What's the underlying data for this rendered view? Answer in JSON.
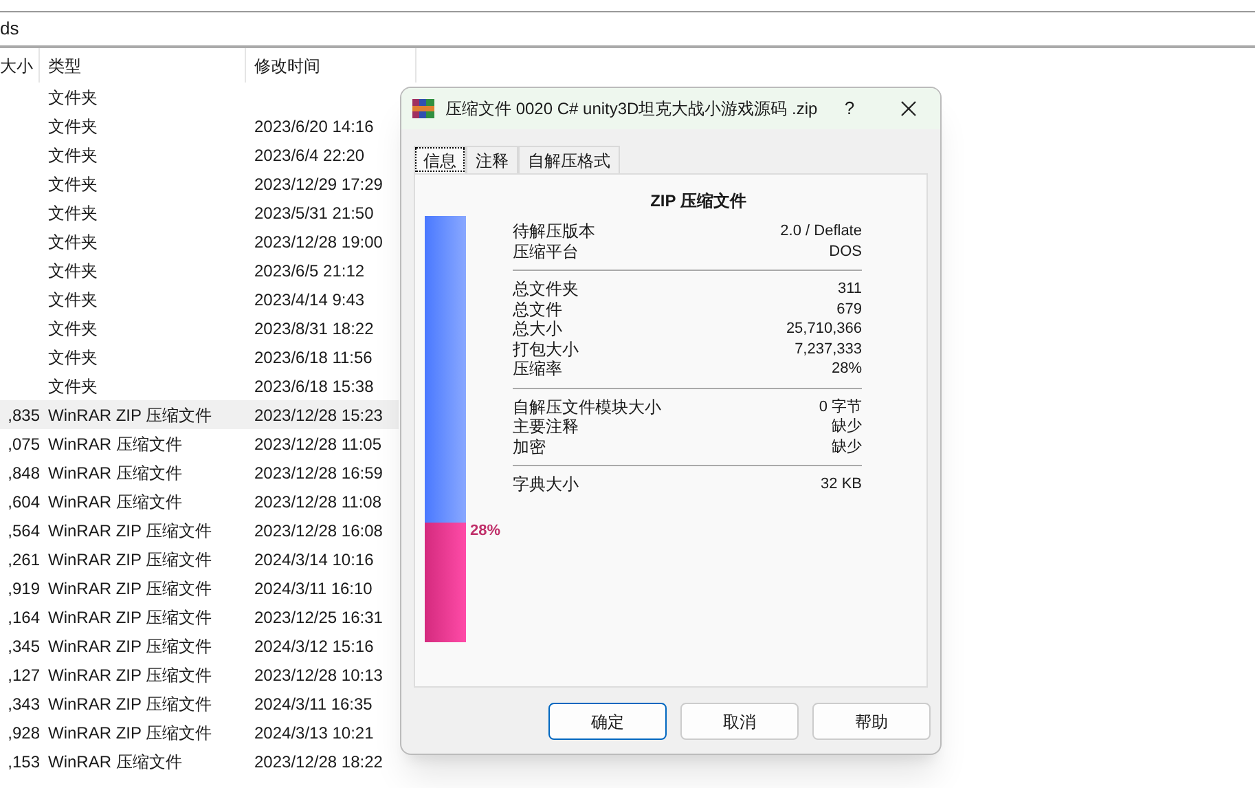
{
  "address_bar": {
    "text": "ds"
  },
  "file_list": {
    "columns": [
      "大小",
      "类型",
      "修改时间"
    ],
    "rows": [
      {
        "size": "",
        "type": "文件夹",
        "modified": "",
        "selected": false
      },
      {
        "size": "",
        "type": "文件夹",
        "modified": "2023/6/20 14:16",
        "selected": false
      },
      {
        "size": "",
        "type": "文件夹",
        "modified": "2023/6/4 22:20",
        "selected": false
      },
      {
        "size": "",
        "type": "文件夹",
        "modified": "2023/12/29 17:29",
        "selected": false
      },
      {
        "size": "",
        "type": "文件夹",
        "modified": "2023/5/31 21:50",
        "selected": false
      },
      {
        "size": "",
        "type": "文件夹",
        "modified": "2023/12/28 19:00",
        "selected": false
      },
      {
        "size": "",
        "type": "文件夹",
        "modified": "2023/6/5 21:12",
        "selected": false
      },
      {
        "size": "",
        "type": "文件夹",
        "modified": "2023/4/14 9:43",
        "selected": false
      },
      {
        "size": "",
        "type": "文件夹",
        "modified": "2023/8/31 18:22",
        "selected": false
      },
      {
        "size": "",
        "type": "文件夹",
        "modified": "2023/6/18 11:56",
        "selected": false
      },
      {
        "size": "",
        "type": "文件夹",
        "modified": "2023/6/18 15:38",
        "selected": false
      },
      {
        "size": ",835",
        "type": "WinRAR ZIP 压缩文件",
        "modified": "2023/12/28 15:23",
        "selected": true
      },
      {
        "size": ",075",
        "type": "WinRAR 压缩文件",
        "modified": "2023/12/28 11:05",
        "selected": false
      },
      {
        "size": ",848",
        "type": "WinRAR 压缩文件",
        "modified": "2023/12/28 16:59",
        "selected": false
      },
      {
        "size": ",604",
        "type": "WinRAR 压缩文件",
        "modified": "2023/12/28 11:08",
        "selected": false
      },
      {
        "size": ",564",
        "type": "WinRAR ZIP 压缩文件",
        "modified": "2023/12/28 16:08",
        "selected": false
      },
      {
        "size": ",261",
        "type": "WinRAR ZIP 压缩文件",
        "modified": "2024/3/14 10:16",
        "selected": false
      },
      {
        "size": ",919",
        "type": "WinRAR ZIP 压缩文件",
        "modified": "2024/3/11 16:10",
        "selected": false
      },
      {
        "size": ",164",
        "type": "WinRAR ZIP 压缩文件",
        "modified": "2023/12/25 16:31",
        "selected": false
      },
      {
        "size": ",345",
        "type": "WinRAR ZIP 压缩文件",
        "modified": "2024/3/12 15:16",
        "selected": false
      },
      {
        "size": ",127",
        "type": "WinRAR ZIP 压缩文件",
        "modified": "2023/12/28 10:13",
        "selected": false
      },
      {
        "size": ",343",
        "type": "WinRAR ZIP 压缩文件",
        "modified": "2024/3/11 16:35",
        "selected": false
      },
      {
        "size": ",928",
        "type": "WinRAR ZIP 压缩文件",
        "modified": "2024/3/13 10:21",
        "selected": false
      },
      {
        "size": ",153",
        "type": "WinRAR 压缩文件",
        "modified": "2023/12/28 18:22",
        "selected": false
      }
    ]
  },
  "dialog": {
    "title": "压缩文件 0020 C# unity3D坦克大战小游戏源码 .zip",
    "help": "?",
    "tabs": [
      {
        "label": "信息",
        "selected": true
      },
      {
        "label": "注释",
        "selected": false
      },
      {
        "label": "自解压格式",
        "selected": false
      }
    ],
    "heading": "ZIP 压缩文件",
    "ratio_bar": {
      "level": 0.28,
      "label": "28%"
    },
    "sections": [
      [
        {
          "label": "待解压版本",
          "value": "2.0 / Deflate"
        },
        {
          "label": "压缩平台",
          "value": "DOS"
        }
      ],
      [
        {
          "label": "总文件夹",
          "value": "311"
        },
        {
          "label": "总文件",
          "value": "679"
        },
        {
          "label": "总大小",
          "value": "25,710,366"
        },
        {
          "label": "打包大小",
          "value": "7,237,333"
        },
        {
          "label": "压缩率",
          "value": "28%"
        }
      ],
      [
        {
          "label": "自解压文件模块大小",
          "value": "0 字节"
        },
        {
          "label": "主要注释",
          "value": "缺少"
        },
        {
          "label": "加密",
          "value": "缺少"
        }
      ],
      [
        {
          "label": "字典大小",
          "value": "32 KB"
        }
      ]
    ],
    "buttons": [
      {
        "label": "确定",
        "default": true
      },
      {
        "label": "取消",
        "default": false
      },
      {
        "label": "帮助",
        "default": false
      }
    ]
  }
}
